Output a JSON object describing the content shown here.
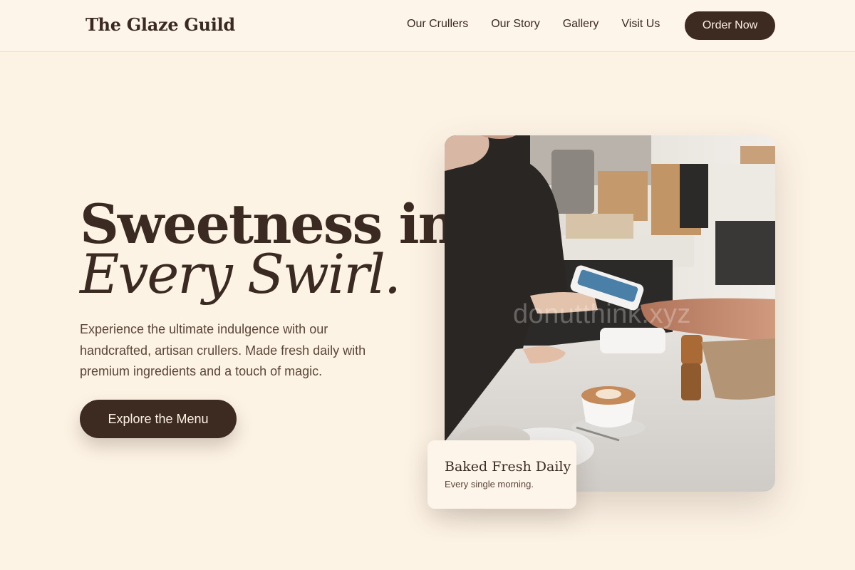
{
  "header": {
    "brand": "The Glaze Guild",
    "nav": [
      "Our Crullers",
      "Our Story",
      "Gallery",
      "Visit Us"
    ],
    "cta_label": "Order Now"
  },
  "hero": {
    "title_line1": "Sweetness in",
    "title_line2": "Every Swirl.",
    "description": "Experience the ultimate indulgence with our handcrafted, artisan crullers. Made fresh daily with premium ingredients and a touch of magic.",
    "cta_label": "Explore the Menu",
    "image": {
      "alt": "Customer paying with card at a café counter next to a latte",
      "watermark": "donutthink.xyz"
    }
  },
  "card": {
    "title": "Baked Fresh Daily",
    "subtitle": "Every single morning."
  },
  "colors": {
    "background": "#fdf3e5",
    "primary": "#3d2a20",
    "text": "#3b2a21",
    "muted_text": "#5a4638"
  }
}
